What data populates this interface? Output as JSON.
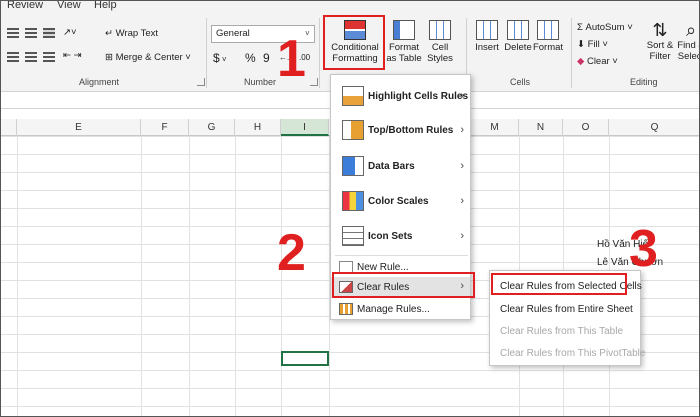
{
  "menubar": {
    "items": [
      "Review",
      "View",
      "Help"
    ]
  },
  "ribbon": {
    "alignment": {
      "wrap_text": "Wrap Text",
      "merge_center": "Merge & Center",
      "label": "Alignment"
    },
    "number": {
      "format": "General",
      "label": "Number",
      "symbols": [
        "$",
        "%",
        "9"
      ]
    },
    "styles": {
      "conditional_formatting": "Conditional Formatting",
      "format_as_table": "Format as Table",
      "cell_styles": "Cell Styles"
    },
    "cells": {
      "insert": "Insert",
      "delete": "Delete",
      "format": "Format",
      "label": "Cells"
    },
    "editing": {
      "autosum": "AutoSum",
      "fill": "Fill",
      "clear": "Clear",
      "sort_filter": "Sort & Filter",
      "find_select": "Find & Select",
      "label": "Editing"
    }
  },
  "columns": [
    "E",
    "F",
    "G",
    "H",
    "I",
    "M",
    "N",
    "O",
    "Q"
  ],
  "cells": {
    "name1": "Hồ Văn Hiế",
    "name2": "Lê Văn Chươn"
  },
  "main_menu": {
    "items": [
      {
        "label": "Highlight Cells Rules",
        "icon": "highlight-cells-icon"
      },
      {
        "label": "Top/Bottom Rules",
        "icon": "top-bottom-icon"
      },
      {
        "label": "Data Bars",
        "icon": "data-bars-icon"
      },
      {
        "label": "Color Scales",
        "icon": "color-scales-icon"
      },
      {
        "label": "Icon Sets",
        "icon": "icon-sets-icon"
      }
    ],
    "new_rule": "New Rule...",
    "clear_rules": "Clear Rules",
    "manage_rules": "Manage Rules..."
  },
  "sub_menu": {
    "items": [
      {
        "label": "Clear Rules from Selected Cells",
        "enabled": true
      },
      {
        "label": "Clear Rules from Entire Sheet",
        "enabled": true
      },
      {
        "label": "Clear Rules from This Table",
        "enabled": false
      },
      {
        "label": "Clear Rules from This PivotTable",
        "enabled": false
      }
    ]
  },
  "steps": [
    "1",
    "2",
    "3"
  ],
  "colors": {
    "annotation_red": "#e02020",
    "excel_green": "#217346"
  }
}
